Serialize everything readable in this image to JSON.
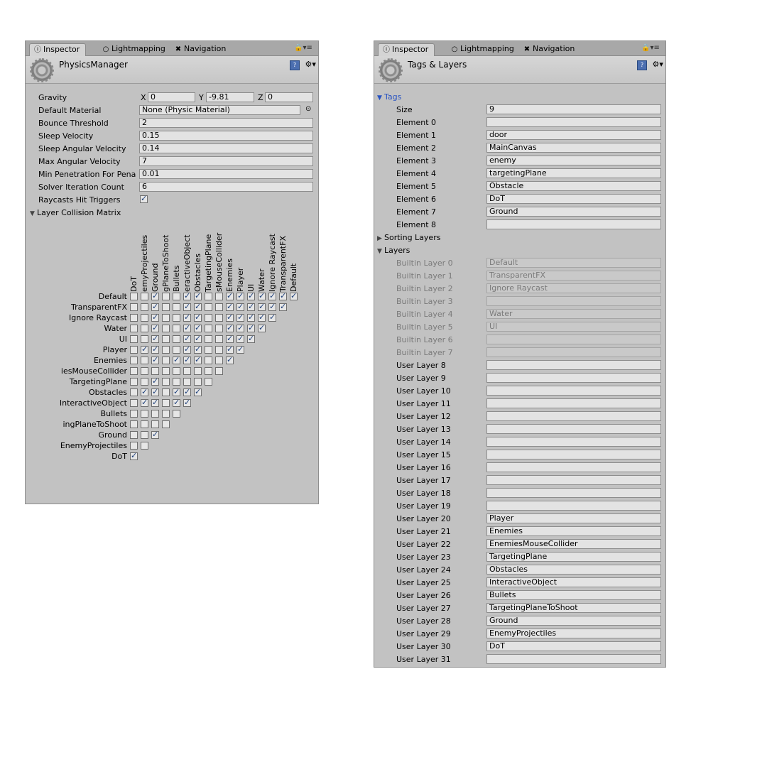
{
  "left": {
    "tabs": [
      "Inspector",
      "Lightmapping",
      "Navigation"
    ],
    "title": "PhysicsManager",
    "gravity": {
      "label": "Gravity",
      "x": "0",
      "y": "-9.81",
      "z": "0",
      "xl": "X",
      "yl": "Y",
      "zl": "Z"
    },
    "properties": [
      {
        "label": "Default Material",
        "value": "None (Physic Material)"
      },
      {
        "label": "Bounce Threshold",
        "value": "2"
      },
      {
        "label": "Sleep Velocity",
        "value": "0.15"
      },
      {
        "label": "Sleep Angular Velocity",
        "value": "0.14"
      },
      {
        "label": "Max Angular Velocity",
        "value": "7"
      },
      {
        "label": "Min Penetration For Pena",
        "value": "0.01"
      },
      {
        "label": "Solver Iteration Count",
        "value": "6"
      }
    ],
    "raycasts": {
      "label": "Raycasts Hit Triggers",
      "checked": true
    },
    "matrix": {
      "title": "Layer Collision Matrix",
      "rows": [
        "Default",
        "TransparentFX",
        "Ignore Raycast",
        "Water",
        "UI",
        "Player",
        "Enemies",
        "iesMouseCollider",
        "TargetingPlane",
        "Obstacles",
        "InteractiveObject",
        "Bullets",
        "ingPlaneToShoot",
        "Ground",
        "EnemyProjectiles",
        "DoT"
      ],
      "cols": [
        "DoT",
        "emyProjectiles",
        "Ground",
        "gPlaneToShoot",
        "Bullets",
        "eractiveObject",
        "Obstacles",
        "TargetingPlane",
        "sMouseCollider",
        "Enemies",
        "Player",
        "UI",
        "Water",
        "Ignore Raycast",
        "TransparentFX",
        "Default"
      ],
      "values": [
        [
          0,
          0,
          1,
          0,
          0,
          1,
          1,
          0,
          0,
          1,
          1,
          1,
          1,
          1,
          1,
          1
        ],
        [
          0,
          0,
          1,
          0,
          0,
          1,
          1,
          0,
          0,
          1,
          1,
          1,
          1,
          1,
          1
        ],
        [
          0,
          0,
          1,
          0,
          0,
          1,
          1,
          0,
          0,
          1,
          1,
          1,
          1,
          1
        ],
        [
          0,
          0,
          1,
          0,
          0,
          1,
          1,
          0,
          0,
          1,
          1,
          1,
          1
        ],
        [
          0,
          0,
          1,
          0,
          0,
          1,
          1,
          0,
          0,
          1,
          1,
          1
        ],
        [
          0,
          1,
          1,
          0,
          0,
          1,
          1,
          0,
          0,
          1,
          1
        ],
        [
          0,
          0,
          1,
          0,
          1,
          1,
          1,
          0,
          0,
          1
        ],
        [
          0,
          0,
          0,
          0,
          0,
          0,
          0,
          0,
          0
        ],
        [
          0,
          0,
          1,
          0,
          0,
          0,
          0,
          0
        ],
        [
          0,
          1,
          1,
          0,
          1,
          1,
          1
        ],
        [
          0,
          1,
          1,
          0,
          1,
          1
        ],
        [
          0,
          0,
          0,
          0,
          0
        ],
        [
          0,
          0,
          0,
          0
        ],
        [
          0,
          0,
          1
        ],
        [
          0,
          0
        ],
        [
          1
        ]
      ]
    }
  },
  "right": {
    "tabs": [
      "Inspector",
      "Lightmapping",
      "Navigation"
    ],
    "title": "Tags & Layers",
    "tags_label": "Tags",
    "size_label": "Size",
    "size_value": "9",
    "elements": [
      {
        "label": "Element 0",
        "value": ""
      },
      {
        "label": "Element 1",
        "value": "door"
      },
      {
        "label": "Element 2",
        "value": "MainCanvas"
      },
      {
        "label": "Element 3",
        "value": "enemy"
      },
      {
        "label": "Element 4",
        "value": "targetingPlane"
      },
      {
        "label": "Element 5",
        "value": "Obstacle"
      },
      {
        "label": "Element 6",
        "value": "DoT"
      },
      {
        "label": "Element 7",
        "value": "Ground"
      },
      {
        "label": "Element 8",
        "value": ""
      }
    ],
    "sorting_layers_label": "Sorting Layers",
    "layers_label": "Layers",
    "layers": [
      {
        "label": "Builtin Layer 0",
        "value": "Default",
        "builtin": true
      },
      {
        "label": "Builtin Layer 1",
        "value": "TransparentFX",
        "builtin": true
      },
      {
        "label": "Builtin Layer 2",
        "value": "Ignore Raycast",
        "builtin": true
      },
      {
        "label": "Builtin Layer 3",
        "value": "",
        "builtin": true
      },
      {
        "label": "Builtin Layer 4",
        "value": "Water",
        "builtin": true
      },
      {
        "label": "Builtin Layer 5",
        "value": "UI",
        "builtin": true
      },
      {
        "label": "Builtin Layer 6",
        "value": "",
        "builtin": true
      },
      {
        "label": "Builtin Layer 7",
        "value": "",
        "builtin": true
      },
      {
        "label": "User Layer 8",
        "value": ""
      },
      {
        "label": "User Layer 9",
        "value": ""
      },
      {
        "label": "User Layer 10",
        "value": ""
      },
      {
        "label": "User Layer 11",
        "value": ""
      },
      {
        "label": "User Layer 12",
        "value": ""
      },
      {
        "label": "User Layer 13",
        "value": ""
      },
      {
        "label": "User Layer 14",
        "value": ""
      },
      {
        "label": "User Layer 15",
        "value": ""
      },
      {
        "label": "User Layer 16",
        "value": ""
      },
      {
        "label": "User Layer 17",
        "value": ""
      },
      {
        "label": "User Layer 18",
        "value": ""
      },
      {
        "label": "User Layer 19",
        "value": ""
      },
      {
        "label": "User Layer 20",
        "value": "Player"
      },
      {
        "label": "User Layer 21",
        "value": "Enemies"
      },
      {
        "label": "User Layer 22",
        "value": "EnemiesMouseCollider"
      },
      {
        "label": "User Layer 23",
        "value": "TargetingPlane"
      },
      {
        "label": "User Layer 24",
        "value": "Obstacles"
      },
      {
        "label": "User Layer 25",
        "value": "InteractiveObject"
      },
      {
        "label": "User Layer 26",
        "value": "Bullets"
      },
      {
        "label": "User Layer 27",
        "value": "TargetingPlaneToShoot"
      },
      {
        "label": "User Layer 28",
        "value": "Ground"
      },
      {
        "label": "User Layer 29",
        "value": "EnemyProjectiles"
      },
      {
        "label": "User Layer 30",
        "value": "DoT"
      },
      {
        "label": "User Layer 31",
        "value": ""
      }
    ]
  }
}
